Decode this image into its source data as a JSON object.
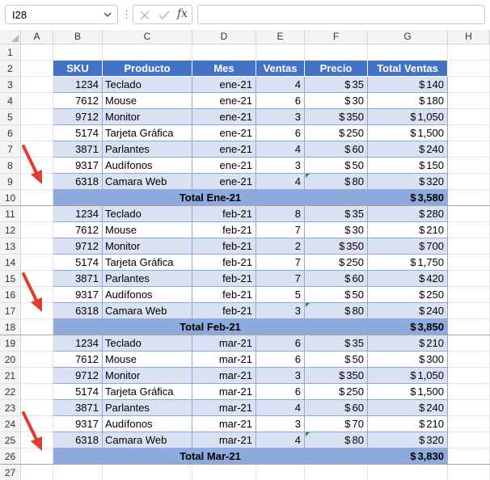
{
  "name_box": {
    "value": "I28"
  },
  "formula_bar": {
    "fx_label": "fx",
    "value": ""
  },
  "columns": [
    "A",
    "B",
    "C",
    "D",
    "E",
    "F",
    "G",
    "H"
  ],
  "rows": [
    "1",
    "2",
    "3",
    "4",
    "5",
    "6",
    "7",
    "8",
    "9",
    "10",
    "11",
    "12",
    "13",
    "14",
    "15",
    "16",
    "17",
    "18",
    "19",
    "20",
    "21",
    "22",
    "23",
    "24",
    "25",
    "26",
    "27"
  ],
  "table_header": {
    "sku": "SKU",
    "producto": "Producto",
    "mes": "Mes",
    "ventas": "Ventas",
    "precio": "Precio",
    "total": "Total Ventas"
  },
  "groups": [
    {
      "items": [
        {
          "sku": "1234",
          "producto": "Teclado",
          "mes": "ene-21",
          "ventas": "4",
          "precio": "35",
          "total": "140"
        },
        {
          "sku": "7612",
          "producto": "Mouse",
          "mes": "ene-21",
          "ventas": "6",
          "precio": "30",
          "total": "180"
        },
        {
          "sku": "9712",
          "producto": "Monitor",
          "mes": "ene-21",
          "ventas": "3",
          "precio": "350",
          "total": "1,050"
        },
        {
          "sku": "5174",
          "producto": "Tarjeta Gráfica",
          "mes": "ene-21",
          "ventas": "6",
          "precio": "250",
          "total": "1,500"
        },
        {
          "sku": "3871",
          "producto": "Parlantes",
          "mes": "ene-21",
          "ventas": "4",
          "precio": "60",
          "total": "240"
        },
        {
          "sku": "9317",
          "producto": "Audífonos",
          "mes": "ene-21",
          "ventas": "3",
          "precio": "50",
          "total": "150"
        },
        {
          "sku": "6318",
          "producto": "Camara Web",
          "mes": "ene-21",
          "ventas": "4",
          "precio": "80",
          "total": "320"
        }
      ],
      "total_label": "Total Ene-21",
      "total_value": "3,580"
    },
    {
      "items": [
        {
          "sku": "1234",
          "producto": "Teclado",
          "mes": "feb-21",
          "ventas": "8",
          "precio": "35",
          "total": "280"
        },
        {
          "sku": "7612",
          "producto": "Mouse",
          "mes": "feb-21",
          "ventas": "7",
          "precio": "30",
          "total": "210"
        },
        {
          "sku": "9712",
          "producto": "Monitor",
          "mes": "feb-21",
          "ventas": "2",
          "precio": "350",
          "total": "700"
        },
        {
          "sku": "5174",
          "producto": "Tarjeta Gráfica",
          "mes": "feb-21",
          "ventas": "7",
          "precio": "250",
          "total": "1,750"
        },
        {
          "sku": "3871",
          "producto": "Parlantes",
          "mes": "feb-21",
          "ventas": "7",
          "precio": "60",
          "total": "420"
        },
        {
          "sku": "9317",
          "producto": "Audífonos",
          "mes": "feb-21",
          "ventas": "5",
          "precio": "50",
          "total": "250"
        },
        {
          "sku": "6318",
          "producto": "Camara Web",
          "mes": "feb-21",
          "ventas": "3",
          "precio": "80",
          "total": "240"
        }
      ],
      "total_label": "Total Feb-21",
      "total_value": "3,850"
    },
    {
      "items": [
        {
          "sku": "1234",
          "producto": "Teclado",
          "mes": "mar-21",
          "ventas": "6",
          "precio": "35",
          "total": "210"
        },
        {
          "sku": "7612",
          "producto": "Mouse",
          "mes": "mar-21",
          "ventas": "6",
          "precio": "50",
          "total": "300"
        },
        {
          "sku": "9712",
          "producto": "Monitor",
          "mes": "mar-21",
          "ventas": "3",
          "precio": "350",
          "total": "1,050"
        },
        {
          "sku": "5174",
          "producto": "Tarjeta Gráfica",
          "mes": "mar-21",
          "ventas": "6",
          "precio": "250",
          "total": "1,500"
        },
        {
          "sku": "3871",
          "producto": "Parlantes",
          "mes": "mar-21",
          "ventas": "4",
          "precio": "60",
          "total": "240"
        },
        {
          "sku": "9317",
          "producto": "Audífonos",
          "mes": "mar-21",
          "ventas": "3",
          "precio": "70",
          "total": "210"
        },
        {
          "sku": "6318",
          "producto": "Camara Web",
          "mes": "mar-21",
          "ventas": "4",
          "precio": "80",
          "total": "320"
        }
      ],
      "total_label": "Total Mar-21",
      "total_value": "3,830"
    }
  ],
  "currency_symbol": "$",
  "colors": {
    "header_fill": "#4472c4",
    "band_fill": "#d9e1f2",
    "total_fill": "#8ea9db",
    "arrow": "#e03c31"
  }
}
